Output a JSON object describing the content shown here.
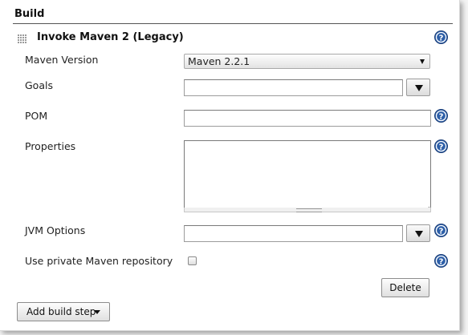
{
  "section": {
    "title": "Build"
  },
  "step": {
    "title": "Invoke Maven 2 (Legacy)",
    "drag_icon": "drag-handle-icon"
  },
  "fields": {
    "maven_version": {
      "label": "Maven Version",
      "selected": "Maven 2.2.1"
    },
    "goals": {
      "label": "Goals",
      "value": ""
    },
    "pom": {
      "label": "POM",
      "value": ""
    },
    "properties": {
      "label": "Properties",
      "value": ""
    },
    "jvm_options": {
      "label": "JVM Options",
      "value": ""
    },
    "private_repo": {
      "label": "Use private Maven repository",
      "checked": false
    }
  },
  "buttons": {
    "delete": "Delete",
    "add_build_step": "Add build step"
  },
  "icons": {
    "help": "help-icon",
    "expand": "expand-arrow-icon",
    "dropdown": "chevron-down-icon"
  },
  "colors": {
    "help_blue": "#2d5fa8",
    "rule": "#555555"
  }
}
